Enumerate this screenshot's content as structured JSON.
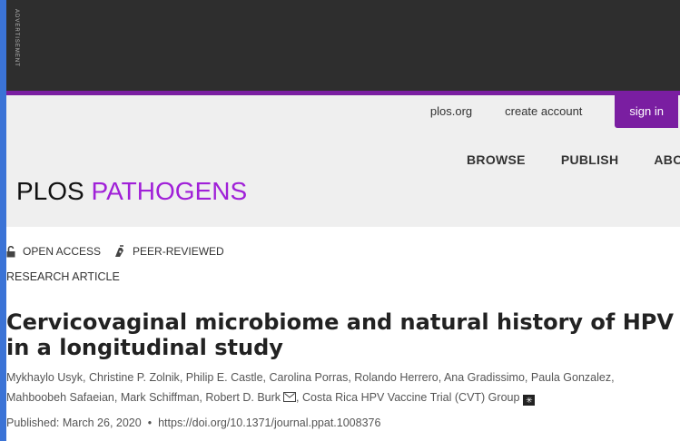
{
  "ad": {
    "label": "ADVERTISEMENT"
  },
  "top_links": {
    "plos": "plos.org",
    "create": "create account",
    "signin": "sign in"
  },
  "nav": [
    "BROWSE",
    "PUBLISH",
    "ABOUT"
  ],
  "logo": {
    "plos": "PLOS",
    "journal": "PATHOGENS"
  },
  "badges": {
    "open_access": "OPEN ACCESS",
    "peer_reviewed": "PEER-REVIEWED"
  },
  "article_type": "RESEARCH ARTICLE",
  "title": "Cervicovaginal microbiome and natural history of HPV in a longitudinal study",
  "authors": [
    "Mykhaylo Usyk",
    "Christine P. Zolnik",
    "Philip E. Castle",
    "Carolina Porras",
    "Rolando Herrero",
    "Ana Gradissimo",
    "Paula Gonzalez",
    "Mahboobeh Safaeian",
    "Mark Schiffman",
    "Robert D. Burk",
    "Costa Rica HPV Vaccine Trial (CVT) Group"
  ],
  "published": "Published: March 26, 2020",
  "doi": "https://doi.org/10.1371/journal.ppat.1008376",
  "colors": {
    "accent": "#7a1ea1",
    "journal": "#a020d8",
    "ad_bg": "#2e2e2e",
    "header_bg": "#efefef"
  }
}
